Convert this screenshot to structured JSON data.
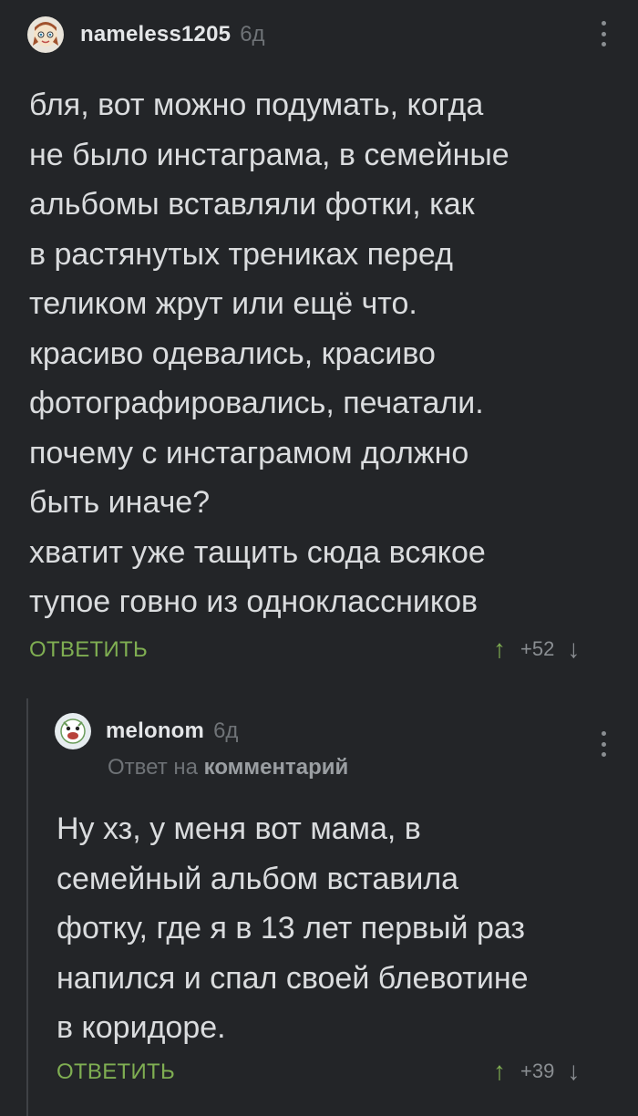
{
  "comments": [
    {
      "username": "nameless1205",
      "age": "6д",
      "text": "бля, вот можно подумать, когда\nне было инстаграма, в семейные\nальбомы вставляли фотки, как\nв растянутых трениках перед\nтеликом жрут или ещё что.\nкрасиво одевались, красиво\nфотографировались, печатали.\nпочему с инстаграмом должно\nбыть иначе?\nхватит уже тащить сюда всякое\nтупое говно из одноклассников",
      "reply_label": "ОТВЕТИТЬ",
      "rating": "+52"
    },
    {
      "username": "melonom",
      "age": "6д",
      "reply_to_prefix": "Ответ на",
      "reply_to_link": "комментарий",
      "text": "Ну хз, у меня вот мама, в\nсемейный альбом вставила\nфотку, где я в 13 лет первый раз\nнапился и спал своей блевотине\nв коридоре.",
      "reply_label": "ОТВЕТИТЬ",
      "rating": "+39"
    }
  ],
  "icons": {
    "upvote": "arrow-up-icon",
    "downvote": "arrow-down-icon",
    "menu": "more-vertical-icon"
  },
  "colors": {
    "background": "#232528",
    "accent": "#7fae52",
    "text": "#dadcde",
    "muted": "#6f7377"
  }
}
